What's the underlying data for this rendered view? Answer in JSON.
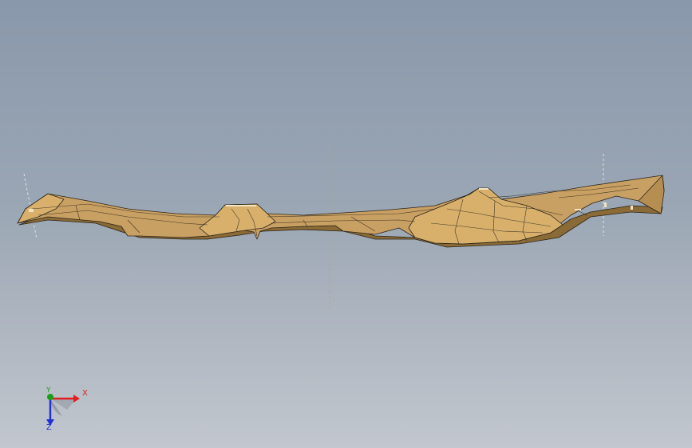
{
  "viewport": {
    "background_top": "#8998ab",
    "background_bottom": "#c2c7ce"
  },
  "model": {
    "fill_color": "#c9a063",
    "shadow_color": "#8a6a36",
    "edge_color": "#2b2418",
    "highlight_color": "#e6c98c"
  },
  "triad": {
    "x_label": "X",
    "y_label": "Y",
    "z_label": "Z",
    "x_color": "#e02020",
    "y_color": "#18a018",
    "z_color": "#2030d8"
  }
}
